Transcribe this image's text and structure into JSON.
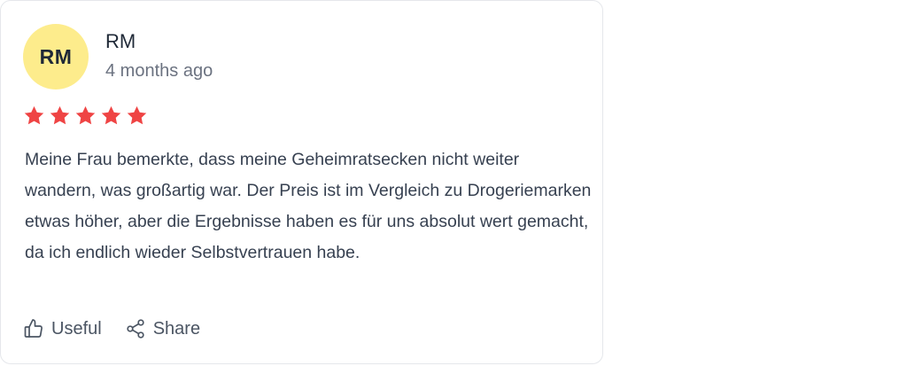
{
  "review": {
    "avatar_initials": "RM",
    "avatar_color": "#fdec8c",
    "author": "RM",
    "date": "4 months ago",
    "rating": 5,
    "rating_max": 5,
    "star_color": "#ef4444",
    "text": "Meine Frau bemerkte, dass meine Geheimratsecken nicht weiter wandern, was großartig war. Der Preis ist im Vergleich zu Drogeriemarken etwas höher, aber die Ergebnisse haben es für uns absolut wert gemacht, da ich endlich wieder Selbstvertrauen habe."
  },
  "actions": {
    "useful_label": "Useful",
    "useful_icon": "thumbs-up-icon",
    "share_label": "Share",
    "share_icon": "share-icon"
  }
}
